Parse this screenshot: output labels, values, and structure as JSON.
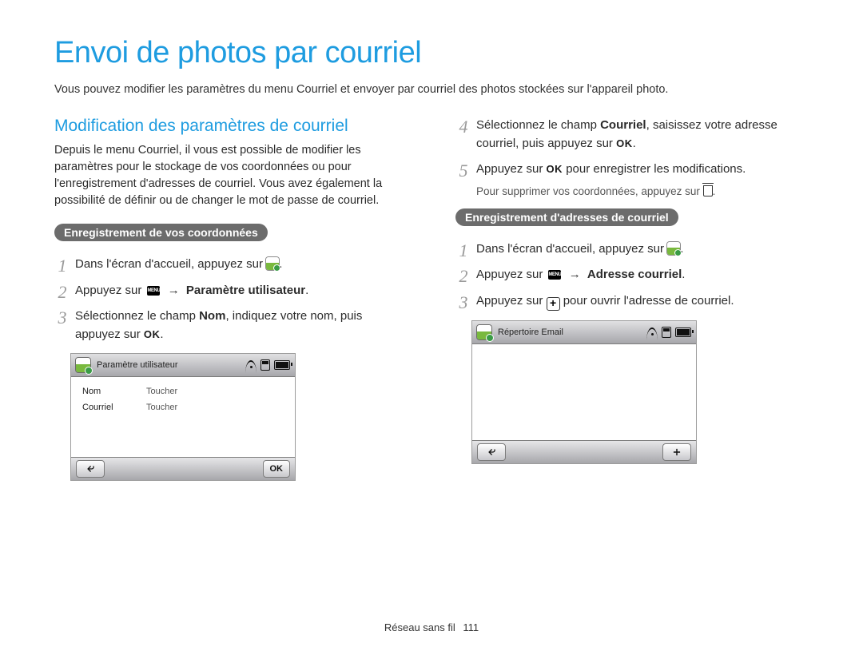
{
  "title": "Envoi de photos par courriel",
  "intro": "Vous pouvez modifier les paramètres du menu Courriel et envoyer par courriel des photos stockées sur l'appareil photo.",
  "section1": {
    "heading": "Modification des paramètres de courriel",
    "para": "Depuis le menu Courriel, il vous est possible de modifier les paramètres pour le stockage de vos coordonnées ou pour l'enregistrement d'adresses de courriel. Vous avez également la possibilité de définir ou de changer le mot de passe de courriel."
  },
  "left_pill": "Enregistrement de vos coordonnées",
  "steps_left": {
    "s1": "Dans l'écran d'accueil, appuyez sur ",
    "s1_end": ".",
    "s2a": "Appuyez sur ",
    "s2b_arrow": "→",
    "s2c": "Paramètre utilisateur",
    "s2_end": ".",
    "s3a": "Sélectionnez le champ ",
    "s3b": "Nom",
    "s3c": ", indiquez votre nom, puis appuyez sur ",
    "s3_end": "."
  },
  "right_top_steps": {
    "s4a": "Sélectionnez le champ ",
    "s4b": "Courriel",
    "s4c": ", saisissez votre adresse courriel, puis appuyez sur ",
    "s4_end": ".",
    "s5a": "Appuyez sur ",
    "s5b": " pour enregistrer les modifications.",
    "note_a": "Pour supprimer vos coordonnées, appuyez sur ",
    "note_end": "."
  },
  "right_pill": "Enregistrement d'adresses de courriel",
  "steps_right": {
    "s1": "Dans l'écran d'accueil, appuyez sur ",
    "s1_end": ".",
    "s2a": "Appuyez sur ",
    "s2b_arrow": "→",
    "s2c": "Adresse courriel",
    "s2_end": ".",
    "s3a": "Appuyez sur ",
    "s3b": " pour ouvrir l'adresse de courriel."
  },
  "mockup_left": {
    "title": "Paramètre utilisateur",
    "row1_label": "Nom",
    "row1_value": "Toucher",
    "row2_label": "Courriel",
    "row2_value": "Toucher",
    "ok": "OK"
  },
  "mockup_right": {
    "title": "Répertoire Email"
  },
  "icons": {
    "ok": "OK",
    "menu": "MENU"
  },
  "footer": {
    "section": "Réseau sans fil",
    "page": "111"
  }
}
